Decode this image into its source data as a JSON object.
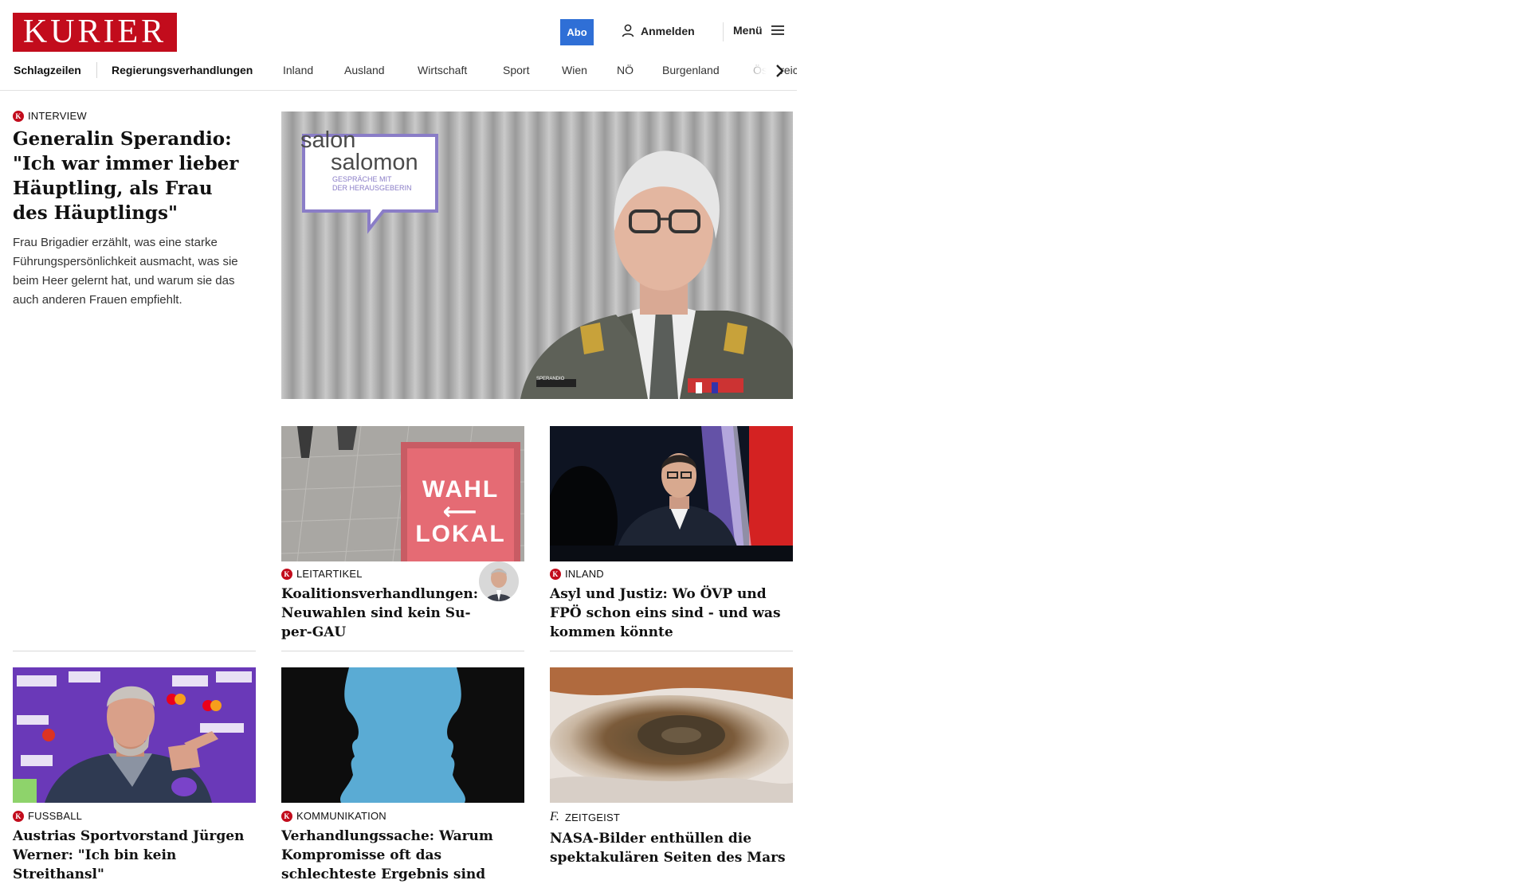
{
  "header": {
    "logo": "KURIER",
    "abo_label": "Abo",
    "login_label": "Anmelden",
    "menu_label": "Menü"
  },
  "nav": {
    "items": [
      "Schlagzeilen",
      "Regierungsverhandlungen",
      "Inland",
      "Ausland",
      "Wirtschaft",
      "Sport",
      "Wien",
      "NÖ",
      "Burgenland",
      "Österreich"
    ]
  },
  "lead": {
    "kicker": "Interview",
    "headline": "Generalin Sperandio: \"Ich war immer lieber Häupt­ling, als Frau des Häuptlings\"",
    "teaser": "Frau Brigadier erzählt, was eine starke Führungspersönlichkeit ausmacht, was sie beim Heer gelernt hat, und warum sie das auch anderen Frauen empfiehlt.",
    "image_badge": {
      "line1": "salon",
      "line2": "salomon",
      "line3": "GESPRÄCHE MIT",
      "line4": "DER HERAUSGEBERIN"
    },
    "name_tag": "SPERANDIO"
  },
  "cards": [
    {
      "kicker": "Leitartikel",
      "headline": "Koalitionsverhandlungen: Neuwahlen sind kein Su­per-GAU",
      "image_text": [
        "WAHL",
        "LOKAL"
      ]
    },
    {
      "kicker": "Inland",
      "headline": "Asyl und Justiz: Wo ÖVP und FPÖ schon eins sind - und was kommen könnte"
    },
    {
      "kicker": "Fussball",
      "headline": "Austrias Sportvorstand Jürgen Werner: \"Ich bin kein Streithansl\""
    },
    {
      "kicker": "Kommunikation",
      "headline": "Verhandlungssache: Warum Kom­promisse oft das schlechteste Er­gebnis sind"
    },
    {
      "kicker": "Zeitgeist",
      "headline": "NASA-Bilder enthüllen die spekta­kulären Seiten des Mars"
    }
  ],
  "colors": {
    "brand": "#c20c1c",
    "abo": "#2f6fd6"
  }
}
